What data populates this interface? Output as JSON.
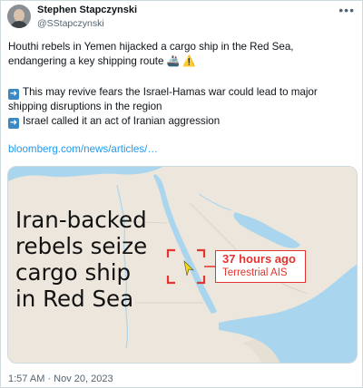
{
  "author": {
    "name": "Stephen Stapczynski",
    "handle": "@SStapczynski"
  },
  "tweet": {
    "line1": "Houthi rebels in Yemen hijacked a cargo ship in the Red Sea,",
    "line2": "endangering a key shipping route",
    "emoji_ship": "🚢",
    "emoji_warning": "⚠️",
    "arrow": "➡️",
    "bullet1_line1": "This may revive fears the Israel-Hamas war could lead to major",
    "bullet1_line2": "shipping disruptions in the region",
    "bullet2": "Israel called it an act of Iranian aggression",
    "link": "bloomberg.com/news/articles/…"
  },
  "media": {
    "headline_line1": "Iran-backed",
    "headline_line2": "rebels seize",
    "headline_line3": "cargo ship",
    "headline_line4": "in Red Sea",
    "callout_time": "37 hours ago",
    "callout_source": "Terrestrial AIS"
  },
  "footer": {
    "timestamp": "1:57 AM · Nov 20, 2023"
  },
  "colors": {
    "link": "#1d9bf0",
    "callout": "#e3342f",
    "land": "#ece6dc",
    "sea": "#a9d6ee"
  }
}
